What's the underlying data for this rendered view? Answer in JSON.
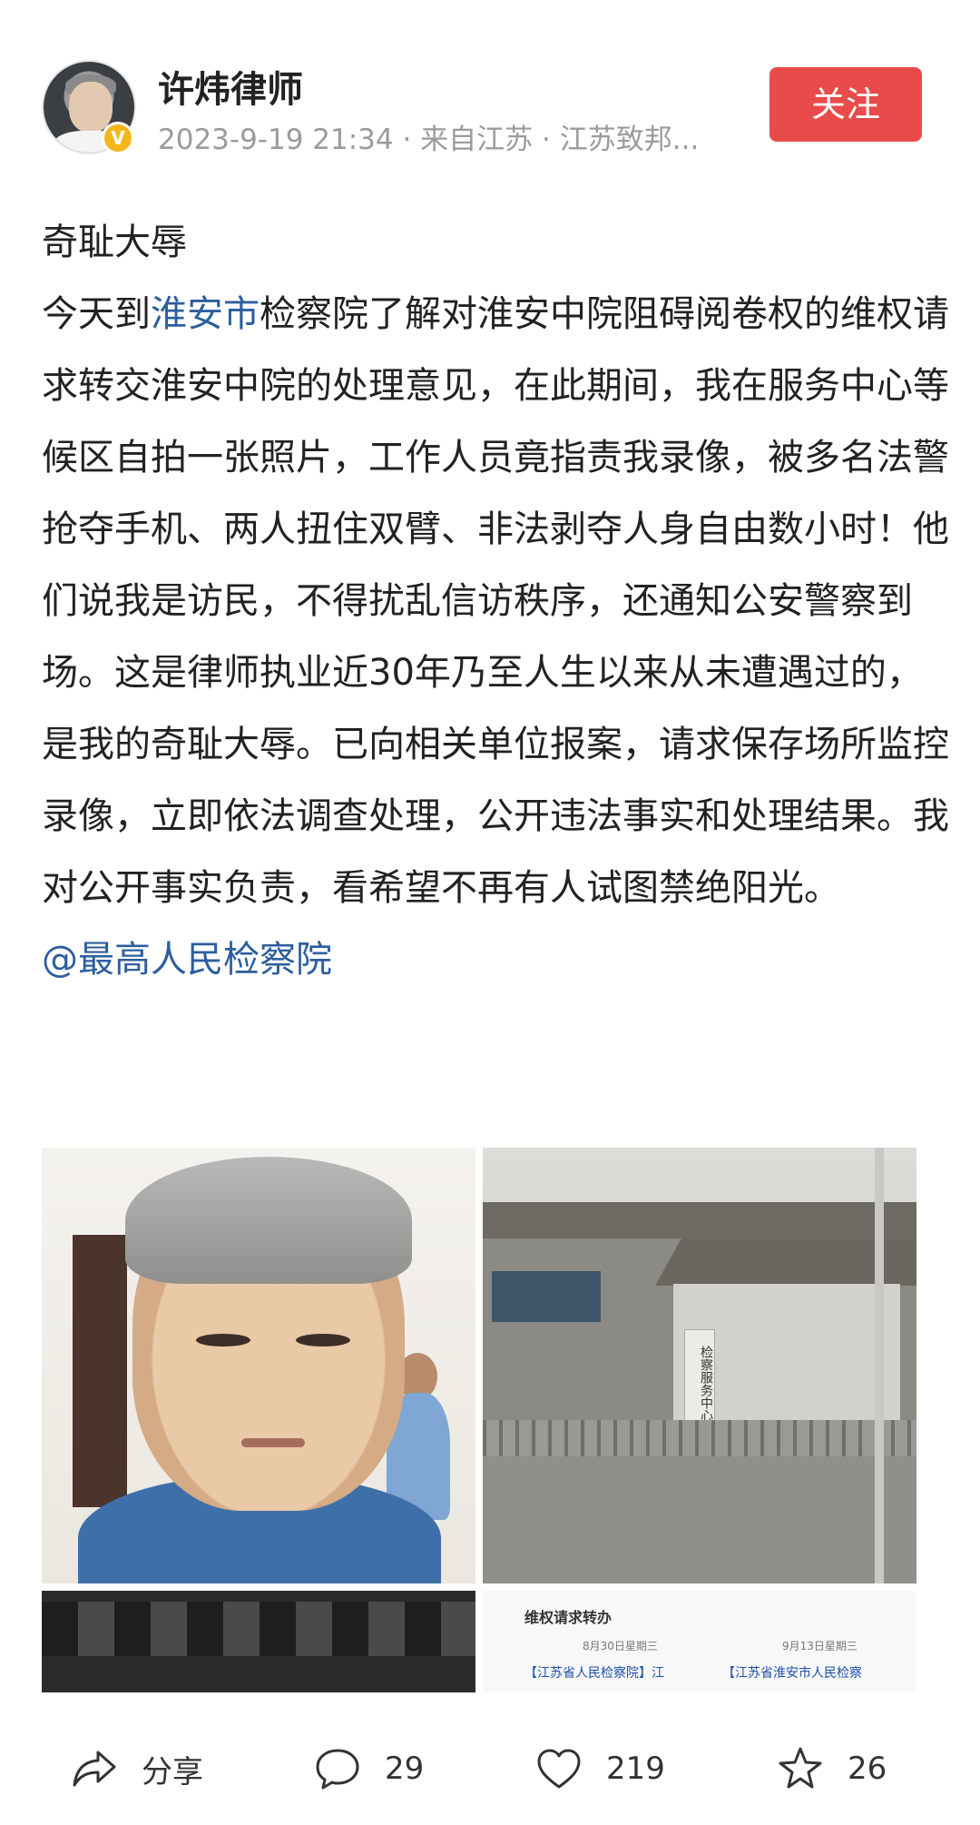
{
  "author": {
    "name": "许炜律师",
    "verified_badge": "V",
    "meta": "2023-9-19 21:34 · 来自江苏 · 江苏致邦..."
  },
  "follow_label": "关注",
  "post": {
    "title": "奇耻大辱",
    "body_prefix": "今天到",
    "body_link": "淮安市",
    "body_rest": "检察院了解对淮安中院阻碍阅卷权的维权请求转交淮安中院的处理意见，在此期间，我在服务中心等候区自拍一张照片，工作人员竟指责我录像，被多名法警抢夺手机、两人扭住双臂、非法剥夺人身自由数小时！他们说我是访民，不得扰乱信访秩序，还通知公安警察到场。这是律师执业近30年乃至人生以来从未遭遇过的，是我的奇耻大辱。已向相关单位报案，请求保存场所监控录像，立即依法调查处理，公开违法事实和处理结果。我对公开事实负责，看希望不再有人试图禁绝阳光。",
    "mention": "@最高人民检察院"
  },
  "images": {
    "building_sign": "检察服务中心",
    "doc_title": "维权请求转办",
    "doc_date_1": "8月30日星期三",
    "doc_date_2": "9月13日星期三",
    "doc_tag_1": "【江苏省人民检察院】江",
    "doc_tag_2": "【江苏省淮安市人民检察"
  },
  "actions": {
    "share": "分享",
    "comments": "29",
    "likes": "219",
    "favorites": "26"
  }
}
